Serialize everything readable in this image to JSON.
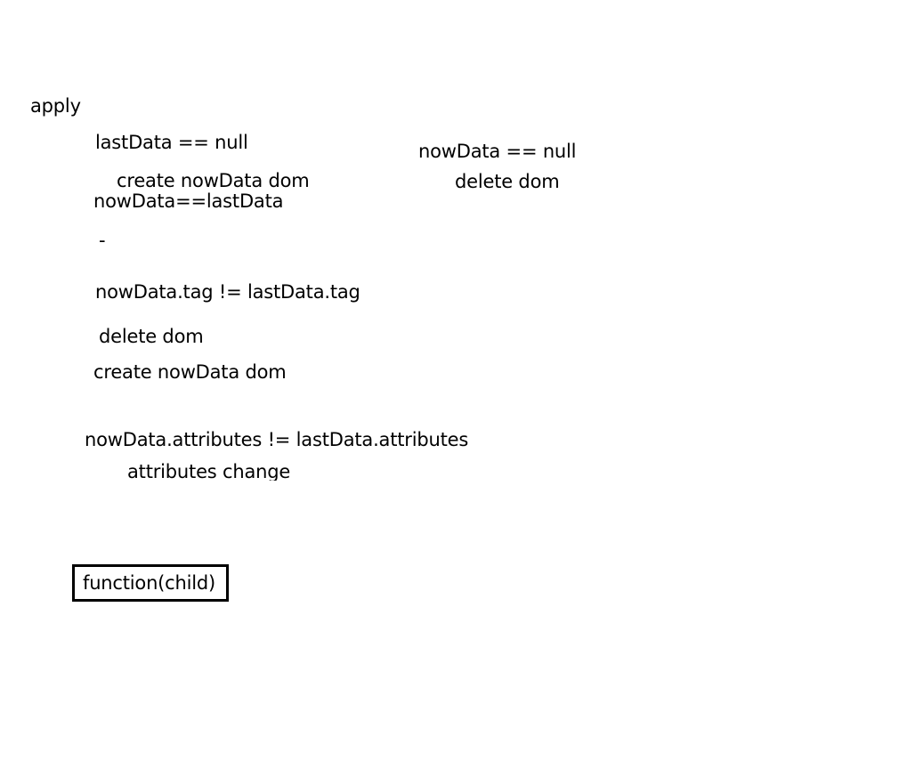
{
  "labels": {
    "apply": "apply",
    "last_null": "lastData == null",
    "create_now_dom_1": "create nowData dom",
    "now_eq_last": "nowData==lastData",
    "dash": "-",
    "tag_not_equal": "nowData.tag != lastData.tag",
    "delete_dom_1": "delete dom",
    "create_now_dom_2": "create nowData dom",
    "attributes_not_equal": "nowData.attributes != lastData.attributes",
    "attributes_change": "attributes change",
    "now_null": "nowData == null",
    "delete_dom_2": "delete dom"
  },
  "function_box": {
    "label": "function(child)"
  }
}
